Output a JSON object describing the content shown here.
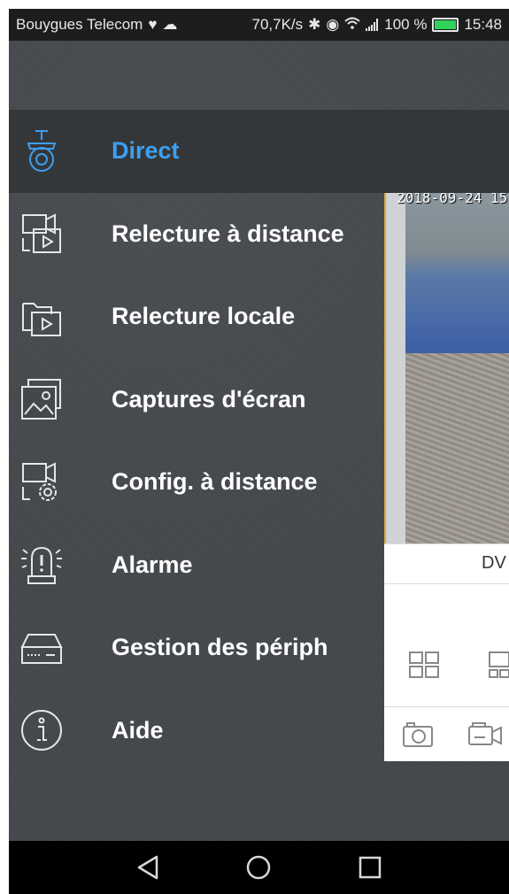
{
  "status_bar": {
    "carrier": "Bouygues Telecom",
    "net_speed": "70,7K/s",
    "battery_percent": "100 %",
    "time": "15:48"
  },
  "menu": {
    "items": [
      {
        "label": "Direct",
        "icon": "camera-icon",
        "active": true
      },
      {
        "label": "Relecture à distance",
        "icon": "remote-playback-icon"
      },
      {
        "label": "Relecture locale",
        "icon": "local-playback-icon"
      },
      {
        "label": "Captures d'écran",
        "icon": "image-icon"
      },
      {
        "label": "Config. à distance",
        "icon": "remote-config-icon"
      },
      {
        "label": "Alarme",
        "icon": "alarm-icon"
      },
      {
        "label": "Gestion des périph",
        "icon": "device-icon"
      },
      {
        "label": "Aide",
        "icon": "info-icon"
      }
    ]
  },
  "app": {
    "timestamp": "2018-09-24 15",
    "device_label": "DV"
  },
  "colors": {
    "accent": "#3f9ff0",
    "topbar": "#2f8fe6",
    "drawer": "#44474b"
  }
}
